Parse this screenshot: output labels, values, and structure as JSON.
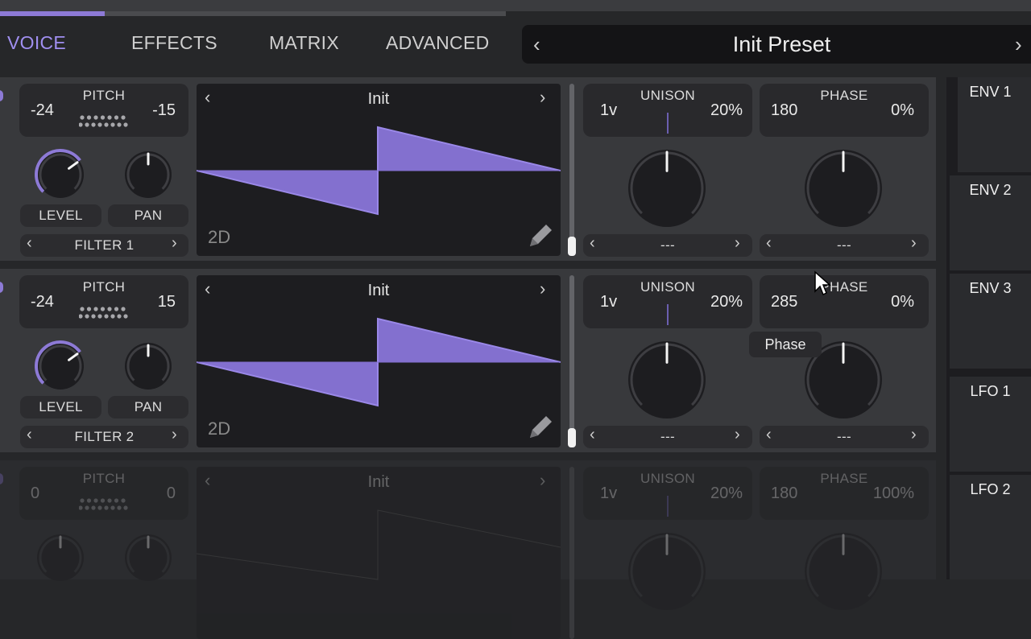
{
  "tabs": [
    "VOICE",
    "EFFECTS",
    "MATRIX",
    "ADVANCED"
  ],
  "active_tab": "VOICE",
  "accent_color": "#8d7ad6",
  "preset": {
    "name": "Init Preset",
    "prev_icon": "chevron-left-icon",
    "next_icon": "chevron-right-icon"
  },
  "oscillators": [
    {
      "pitch_label": "PITCH",
      "pitch_left": "-24",
      "pitch_right": "-15",
      "level_label": "LEVEL",
      "pan_label": "PAN",
      "filter": "FILTER 1",
      "wavetable": "Init",
      "mode": "2D",
      "level": 0.7,
      "unison_label": "UNISON",
      "unison_voices": "1v",
      "unison_detune": "20%",
      "phase_label": "PHASE",
      "phase_value": "180",
      "phase_random": "0%",
      "unison_mod": "---",
      "phase_mod": "---"
    },
    {
      "pitch_label": "PITCH",
      "pitch_left": "-24",
      "pitch_right": "15",
      "level_label": "LEVEL",
      "pan_label": "PAN",
      "filter": "FILTER 2",
      "wavetable": "Init",
      "mode": "2D",
      "level": 0.7,
      "unison_label": "UNISON",
      "unison_voices": "1v",
      "unison_detune": "20%",
      "phase_label": "PHASE",
      "phase_value": "285",
      "phase_random": "0%",
      "unison_mod": "---",
      "phase_mod": "---"
    },
    {
      "pitch_label": "PITCH",
      "pitch_left": "0",
      "pitch_right": "0",
      "level_label": "",
      "pan_label": "",
      "filter": "",
      "wavetable": "Init",
      "mode": "",
      "level": 0.7,
      "unison_label": "UNISON",
      "unison_voices": "1v",
      "unison_detune": "20%",
      "phase_label": "PHASE",
      "phase_value": "180",
      "phase_random": "100%",
      "unison_mod": "",
      "phase_mod": ""
    }
  ],
  "tooltip": "Phase",
  "modulators": [
    "ENV 1",
    "ENV 2",
    "ENV 3",
    "LFO 1",
    "LFO 2"
  ]
}
